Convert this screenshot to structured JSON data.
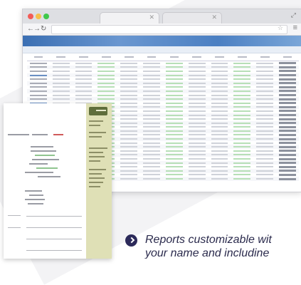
{
  "bullet": {
    "line1": "Reports customizable wit",
    "line2": "your name and includine"
  },
  "browser": {
    "tabs": [
      "",
      ""
    ]
  },
  "colors": {
    "bullet_icon": "#2c2a5a",
    "app_header": "#3b6fb3",
    "doc_sidebar": "#dfe0b6"
  }
}
